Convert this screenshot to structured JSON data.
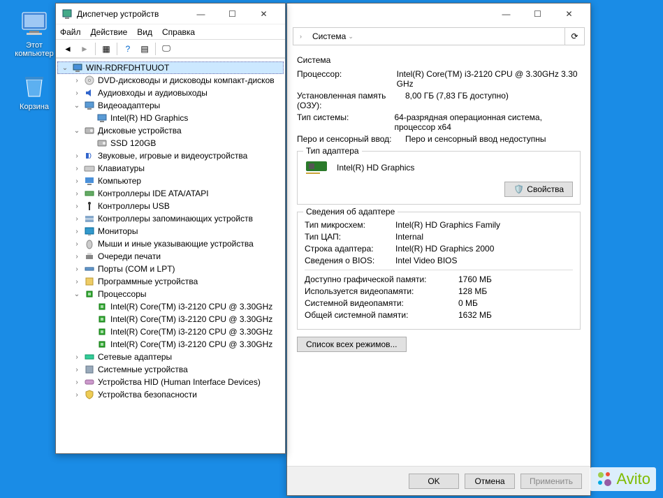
{
  "desktop": {
    "icons": [
      {
        "id": "this-pc",
        "label": "Этот\nкомпьютер"
      },
      {
        "id": "recycle-bin",
        "label": "Корзина"
      }
    ]
  },
  "devmgr": {
    "title": "Диспетчер устройств",
    "menus": [
      "Файл",
      "Действие",
      "Вид",
      "Справка"
    ],
    "root": "WIN-RDRFDHTUUOT",
    "nodes": [
      {
        "label": "DVD-дисководы и дисководы компакт-дисков",
        "exp": ">",
        "ind": 1,
        "icon": "dvd"
      },
      {
        "label": "Аудиовходы и аудиовыходы",
        "exp": ">",
        "ind": 1,
        "icon": "audio"
      },
      {
        "label": "Видеоадаптеры",
        "exp": "v",
        "ind": 1,
        "icon": "video"
      },
      {
        "label": "Intel(R) HD Graphics",
        "exp": "",
        "ind": 2,
        "icon": "video"
      },
      {
        "label": "Дисковые устройства",
        "exp": "v",
        "ind": 1,
        "icon": "disk"
      },
      {
        "label": "SSD 120GB",
        "exp": "",
        "ind": 2,
        "icon": "disk"
      },
      {
        "label": "Звуковые, игровые и видеоустройства",
        "exp": ">",
        "ind": 1,
        "icon": "sound"
      },
      {
        "label": "Клавиатуры",
        "exp": ">",
        "ind": 1,
        "icon": "kbd"
      },
      {
        "label": "Компьютер",
        "exp": ">",
        "ind": 1,
        "icon": "pc"
      },
      {
        "label": "Контроллеры IDE ATA/ATAPI",
        "exp": ">",
        "ind": 1,
        "icon": "ide"
      },
      {
        "label": "Контроллеры USB",
        "exp": ">",
        "ind": 1,
        "icon": "usb"
      },
      {
        "label": "Контроллеры запоминающих устройств",
        "exp": ">",
        "ind": 1,
        "icon": "storage"
      },
      {
        "label": "Мониторы",
        "exp": ">",
        "ind": 1,
        "icon": "monitor"
      },
      {
        "label": "Мыши и иные указывающие устройства",
        "exp": ">",
        "ind": 1,
        "icon": "mouse"
      },
      {
        "label": "Очереди печати",
        "exp": ">",
        "ind": 1,
        "icon": "print"
      },
      {
        "label": "Порты (COM и LPT)",
        "exp": ">",
        "ind": 1,
        "icon": "port"
      },
      {
        "label": "Программные устройства",
        "exp": ">",
        "ind": 1,
        "icon": "soft"
      },
      {
        "label": "Процессоры",
        "exp": "v",
        "ind": 1,
        "icon": "cpu"
      },
      {
        "label": "Intel(R) Core(TM) i3-2120 CPU @ 3.30GHz",
        "exp": "",
        "ind": 2,
        "icon": "cpu"
      },
      {
        "label": "Intel(R) Core(TM) i3-2120 CPU @ 3.30GHz",
        "exp": "",
        "ind": 2,
        "icon": "cpu"
      },
      {
        "label": "Intel(R) Core(TM) i3-2120 CPU @ 3.30GHz",
        "exp": "",
        "ind": 2,
        "icon": "cpu"
      },
      {
        "label": "Intel(R) Core(TM) i3-2120 CPU @ 3.30GHz",
        "exp": "",
        "ind": 2,
        "icon": "cpu"
      },
      {
        "label": "Сетевые адаптеры",
        "exp": ">",
        "ind": 1,
        "icon": "net"
      },
      {
        "label": "Системные устройства",
        "exp": ">",
        "ind": 1,
        "icon": "sys"
      },
      {
        "label": "Устройства HID (Human Interface Devices)",
        "exp": ">",
        "ind": 1,
        "icon": "hid"
      },
      {
        "label": "Устройства безопасности",
        "exp": ">",
        "ind": 1,
        "icon": "sec"
      }
    ]
  },
  "syswin": {
    "breadcrumb": {
      "seg": "Система",
      "refresh": "⟳"
    },
    "sys_legend": "Система",
    "sys_rows": [
      {
        "k": "Процессор:",
        "v": "Intel(R) Core(TM) i3-2120 CPU @ 3.30GHz   3.30 GHz"
      },
      {
        "k": "Установленная память (ОЗУ):",
        "v": "8,00 ГБ (7,83 ГБ доступно)"
      },
      {
        "k": "Тип системы:",
        "v": "64-разрядная операционная система, процессор x64"
      },
      {
        "k": "Перо и сенсорный ввод:",
        "v": "Перо и сенсорный ввод недоступны"
      }
    ],
    "adapter_legend": "Тип адаптера",
    "adapter_name": "Intel(R) HD Graphics",
    "props_btn": "Свойства",
    "info_legend": "Сведения об адаптере",
    "info_rows": [
      {
        "k": "Тип микросхем:",
        "v": "Intel(R) HD Graphics Family"
      },
      {
        "k": "Тип ЦАП:",
        "v": "Internal"
      },
      {
        "k": "Строка адаптера:",
        "v": "Intel(R) HD Graphics 2000"
      },
      {
        "k": "Сведения о BIOS:",
        "v": "Intel Video BIOS"
      }
    ],
    "mem_rows": [
      {
        "k": "Доступно графической памяти:",
        "v": "1760 МБ"
      },
      {
        "k": "Используется видеопамяти:",
        "v": "128 МБ"
      },
      {
        "k": "Системной видеопамяти:",
        "v": "0 МБ"
      },
      {
        "k": "Общей системной памяти:",
        "v": "1632 МБ"
      }
    ],
    "modes_btn": "Список всех режимов...",
    "buttons": {
      "ok": "OK",
      "cancel": "Отмена",
      "apply": "Применить"
    }
  },
  "watermark": "Avito"
}
